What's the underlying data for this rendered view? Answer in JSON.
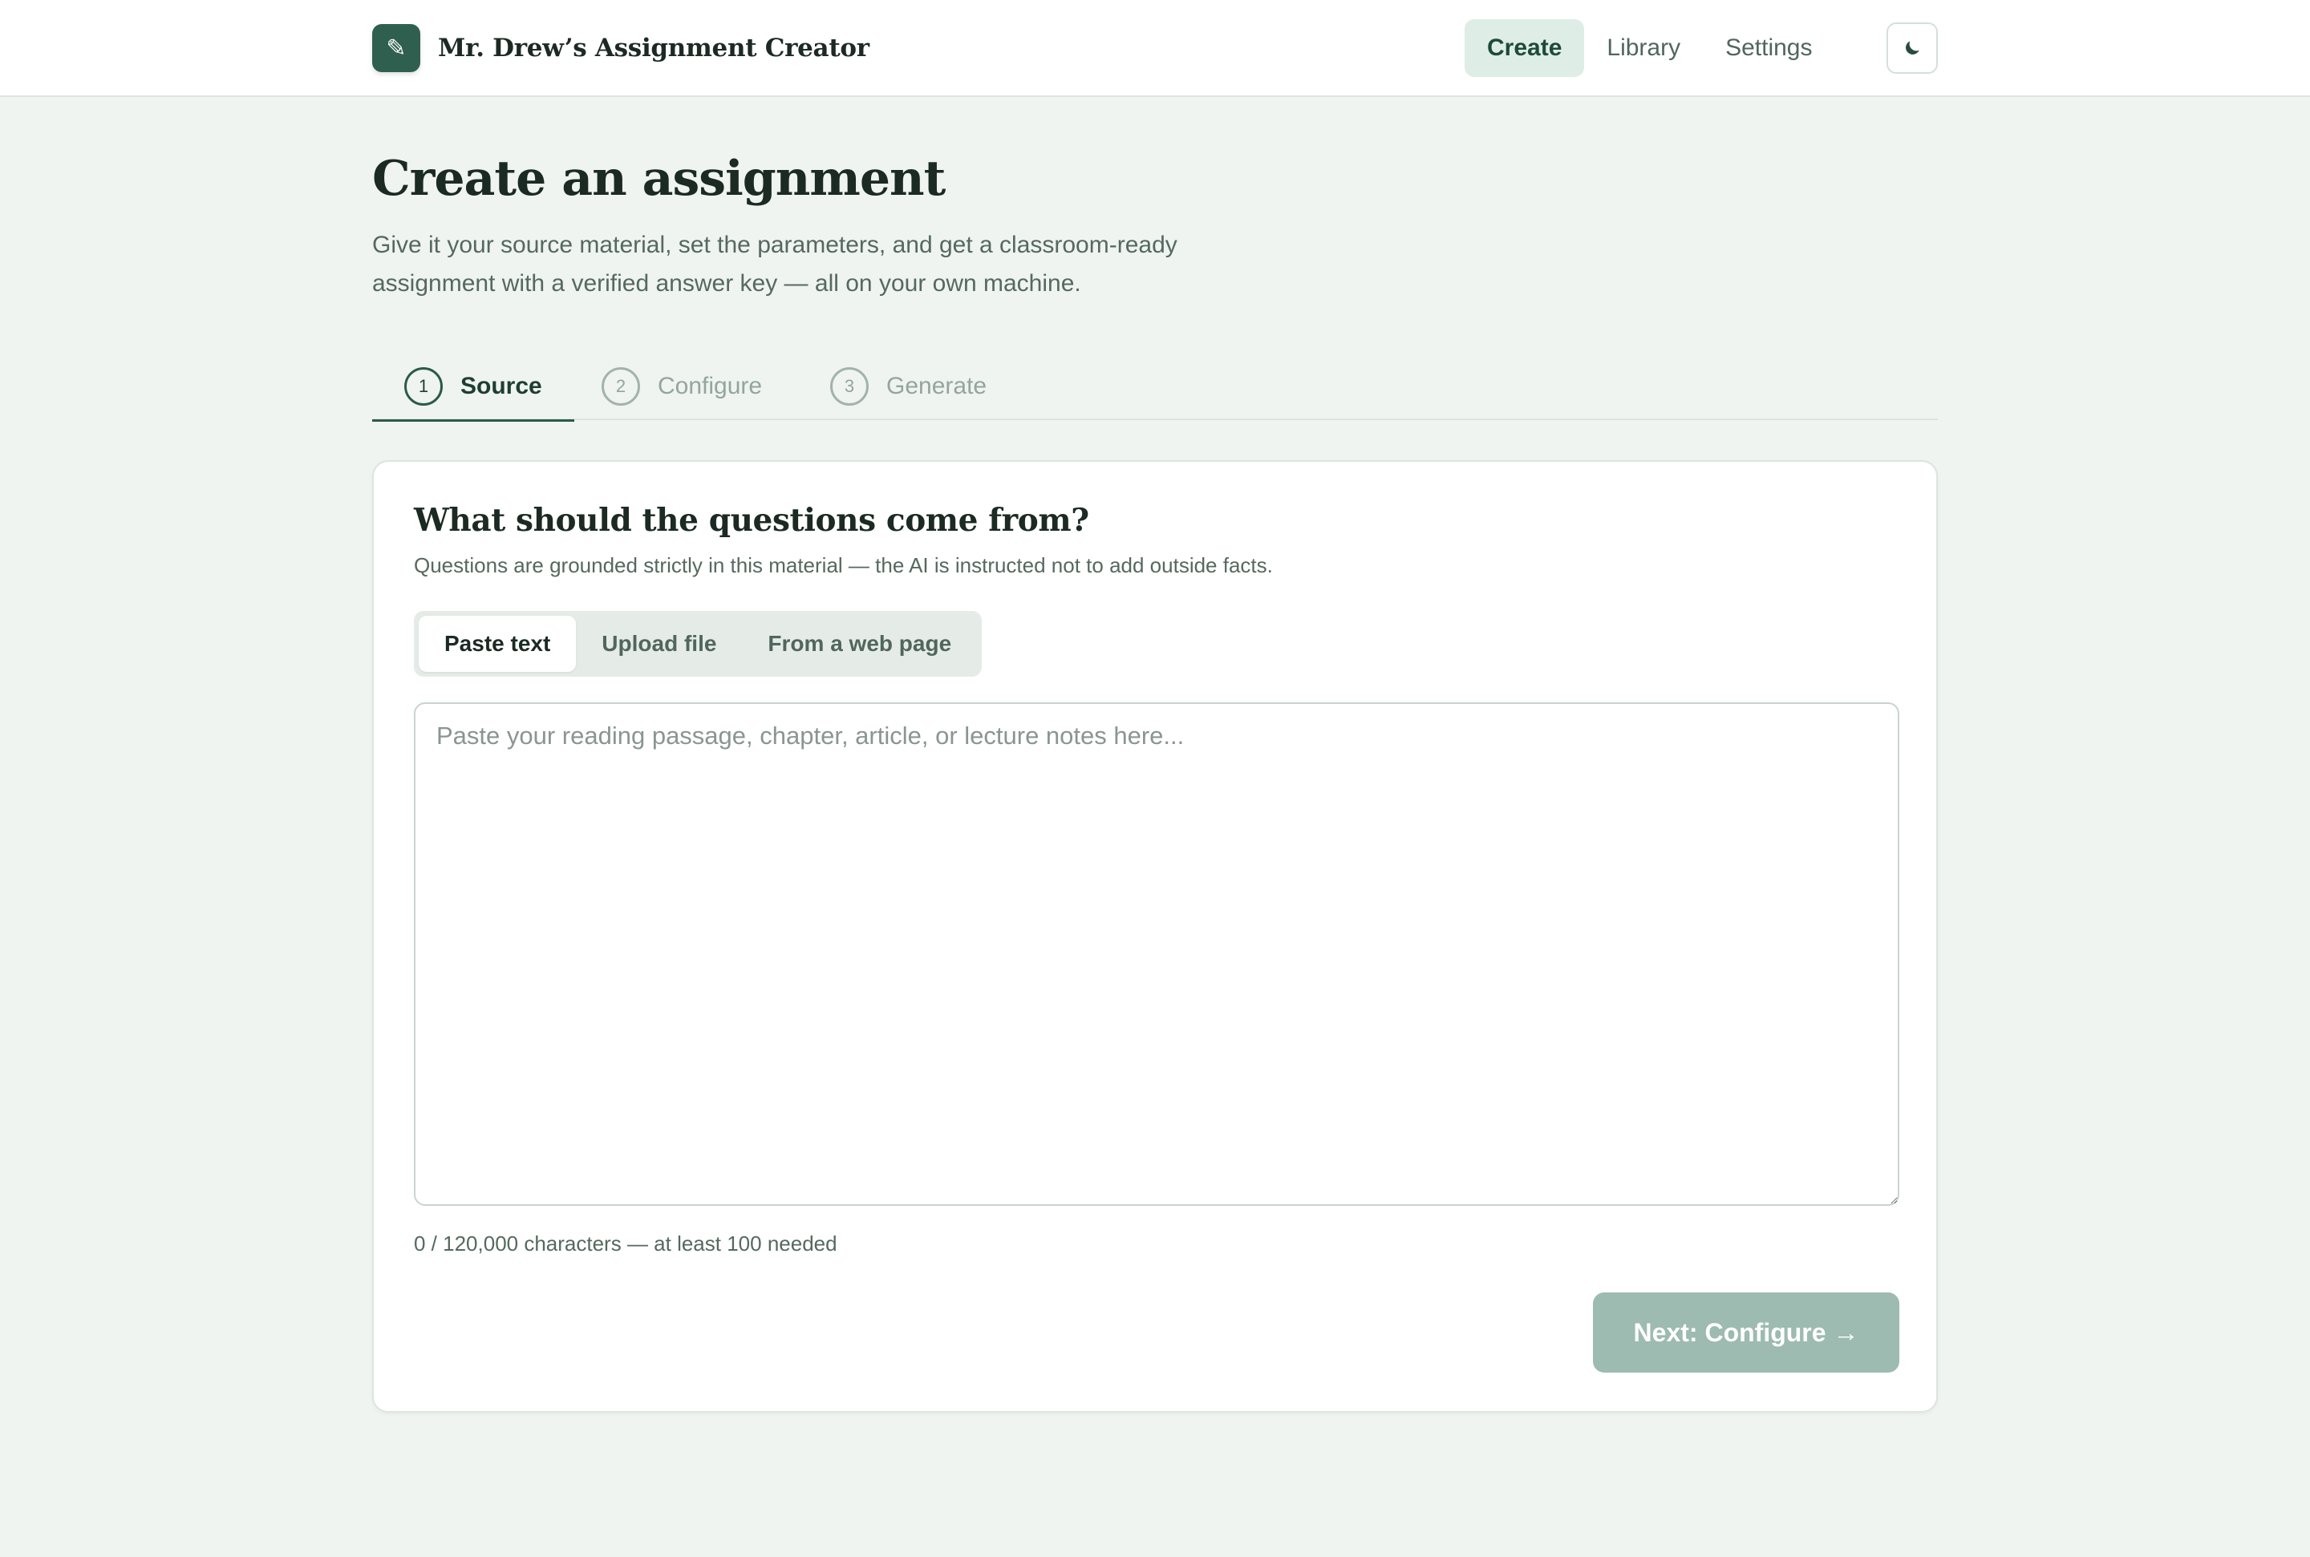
{
  "app": {
    "logo_glyph": "✎",
    "title": "Mr. Drew’s Assignment Creator"
  },
  "nav": {
    "items": [
      {
        "label": "Create",
        "active": true
      },
      {
        "label": "Library",
        "active": false
      },
      {
        "label": "Settings",
        "active": false
      }
    ],
    "theme_toggle_icon": "moon-icon"
  },
  "hero": {
    "title": "Create an assignment",
    "subtitle": "Give it your source material, set the parameters, and get a classroom-ready assignment with a verified answer key — all on your own machine."
  },
  "stepper": {
    "steps": [
      {
        "number": "1",
        "label": "Source",
        "active": true
      },
      {
        "number": "2",
        "label": "Configure",
        "active": false
      },
      {
        "number": "3",
        "label": "Generate",
        "active": false
      }
    ]
  },
  "source_card": {
    "title": "What should the questions come from?",
    "description": "Questions are grounded strictly in this material — the AI is instructed not to add outside facts.",
    "tabs": [
      {
        "label": "Paste text",
        "active": true
      },
      {
        "label": "Upload file",
        "active": false
      },
      {
        "label": "From a web page",
        "active": false
      }
    ],
    "textarea": {
      "value": "",
      "placeholder": "Paste your reading passage, chapter, article, or lecture notes here..."
    },
    "char_count": "0 / 120,000 characters — at least 100 needed",
    "next_button": "Next: Configure →"
  },
  "colors": {
    "accent": "#2f5f4f",
    "page_background": "#eff4f0",
    "disabled_button": "#9dbbb0",
    "nav_active_bg": "#deeee6"
  }
}
